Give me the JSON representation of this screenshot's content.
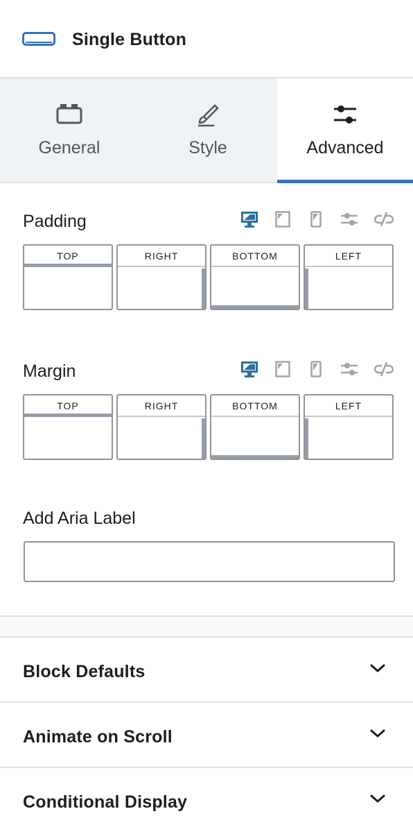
{
  "header": {
    "title": "Single Button",
    "icon": "button-block-icon"
  },
  "tabs": [
    {
      "label": "General",
      "icon": "general-layout-icon",
      "active": false
    },
    {
      "label": "Style",
      "icon": "style-brush-icon",
      "active": false
    },
    {
      "label": "Advanced",
      "icon": "advanced-sliders-icon",
      "active": true
    }
  ],
  "padding": {
    "label": "Padding",
    "sides": {
      "top": "TOP",
      "right": "RIGHT",
      "bottom": "BOTTOM",
      "left": "LEFT"
    }
  },
  "margin": {
    "label": "Margin",
    "sides": {
      "top": "TOP",
      "right": "RIGHT",
      "bottom": "BOTTOM",
      "left": "LEFT"
    }
  },
  "device_icons": [
    "desktop-icon",
    "tablet-icon",
    "mobile-icon",
    "custom-units-icon",
    "unlink-icon"
  ],
  "aria": {
    "label": "Add Aria Label",
    "value": ""
  },
  "panels": [
    {
      "title": "Block Defaults"
    },
    {
      "title": "Animate on Scroll"
    },
    {
      "title": "Conditional Display"
    }
  ],
  "colors": {
    "accent": "#3573b9",
    "active_device": "#2f6f9f",
    "inactive_icon": "#a0a5aa",
    "tab_bg": "#eff2f7"
  }
}
